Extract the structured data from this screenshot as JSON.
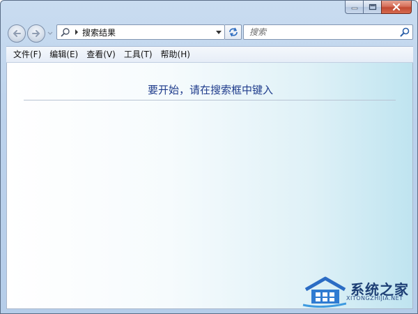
{
  "address": {
    "location": "搜索结果"
  },
  "search": {
    "placeholder": "搜索"
  },
  "menu": {
    "items": [
      {
        "label": "文件(F)"
      },
      {
        "label": "编辑(E)"
      },
      {
        "label": "查看(V)"
      },
      {
        "label": "工具(T)"
      },
      {
        "label": "帮助(H)"
      }
    ]
  },
  "content": {
    "hint": "要开始，请在搜索框中键入"
  },
  "watermark": {
    "title": "系统之家",
    "subtitle": "XITONGZHIJIA.NET"
  },
  "colors": {
    "hint_text": "#1f3c8c",
    "close_button": "#c14a33",
    "content_gradient_end": "#bfe4f0"
  },
  "icons": {
    "back": "back-arrow-icon",
    "forward": "forward-arrow-icon",
    "search": "magnifier-icon",
    "refresh": "refresh-icon"
  }
}
